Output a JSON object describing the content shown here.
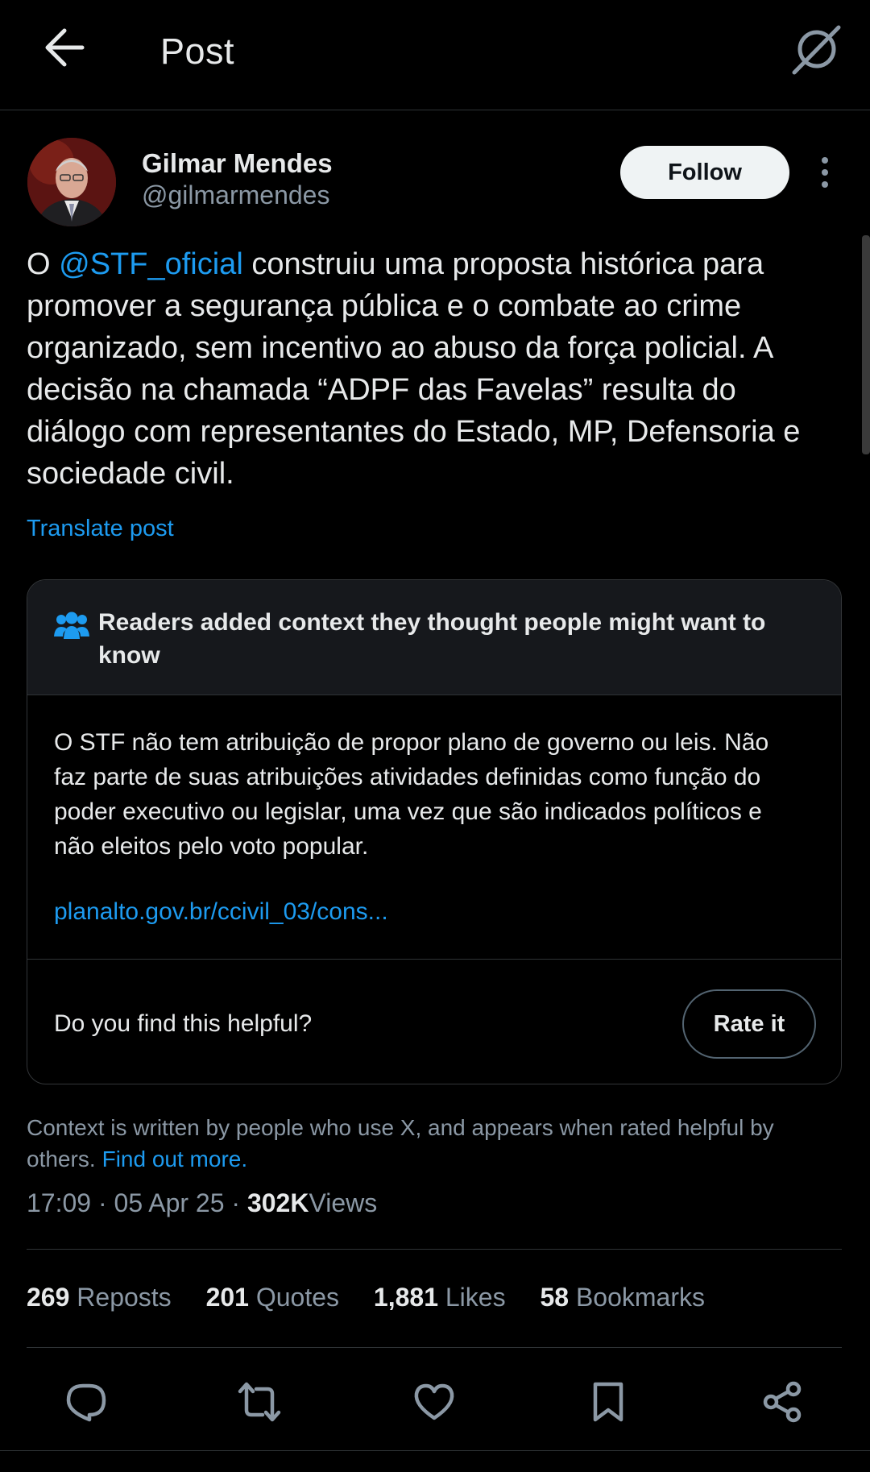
{
  "header": {
    "title": "Post",
    "back_icon": "arrow-left-icon",
    "grok_icon": "grok-icon"
  },
  "author": {
    "name": "Gilmar Mendes",
    "handle": "@gilmarmendes",
    "follow_label": "Follow"
  },
  "post": {
    "text_before": "O ",
    "mention": "@STF_oficial",
    "text_after": " construiu uma proposta histórica para promover a segurança pública e o combate ao crime organizado, sem incentivo ao abuso da força policial. A decisão na chamada “ADPF das Favelas” resulta do diálogo com representantes do Estado, MP, Defensoria e sociedade civil.",
    "translate_label": "Translate post"
  },
  "note": {
    "title": "Readers added context they thought people might want to know",
    "body": "O STF não tem atribuição de propor plano de governo ou leis. Não faz parte de suas atribuições atividades definidas como função do poder executivo ou legislar, uma vez que são indicados políticos e não eleitos pelo voto popular.",
    "link": "planalto.gov.br/ccivil_03/cons...",
    "helpful_question": "Do you find this helpful?",
    "rate_label": "Rate it"
  },
  "context": {
    "text": "Context is written by people who use X, and appears when rated helpful by others.",
    "link": "Find out more."
  },
  "meta": {
    "time": "17:09",
    "date": "05 Apr 25",
    "views_count": "302K",
    "views_label": "Views",
    "sep": "·"
  },
  "stats": [
    {
      "count": "269",
      "label": "Reposts"
    },
    {
      "count": "201",
      "label": "Quotes"
    },
    {
      "count": "1,881",
      "label": "Likes"
    },
    {
      "count": "58",
      "label": "Bookmarks"
    }
  ],
  "actions": [
    "reply-icon",
    "repost-icon",
    "like-icon",
    "bookmark-icon",
    "share-icon"
  ],
  "colors": {
    "accent": "#1d9bf0",
    "background": "#000000",
    "text": "#e7e9ea",
    "muted": "#8b98a5"
  }
}
